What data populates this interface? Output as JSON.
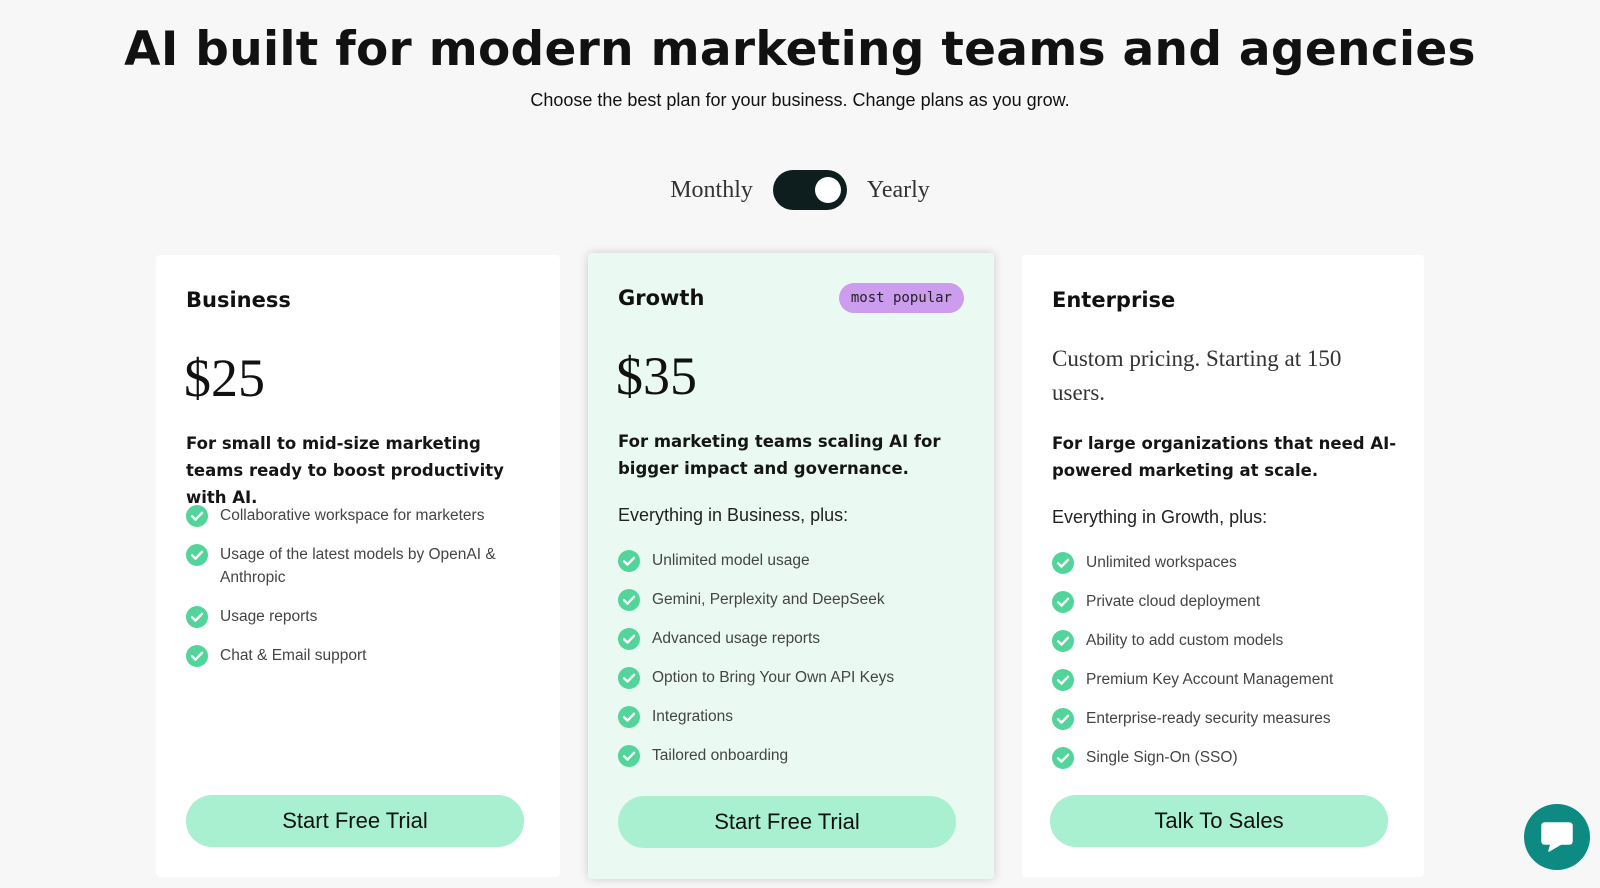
{
  "header": {
    "title": "AI built for modern marketing teams and agencies",
    "subtitle": "Choose the best plan for your business. Change plans as you grow."
  },
  "billing": {
    "monthly_label": "Monthly",
    "yearly_label": "Yearly",
    "selected": "Yearly"
  },
  "plans": [
    {
      "name": "Business",
      "price": "$25",
      "tagline": "For small to mid-size marketing teams ready to boost productivity with AI.",
      "features": [
        "Collaborative workspace for marketers",
        "Usage of the latest models by OpenAI & Anthropic",
        "Usage reports",
        "Chat & Email support"
      ],
      "cta": "Start Free Trial"
    },
    {
      "name": "Growth",
      "badge": "most popular",
      "price": "$35",
      "tagline": "For marketing teams scaling AI for bigger impact and governance.",
      "includes": "Everything in Business, plus:",
      "features": [
        "Unlimited model usage",
        "Gemini, Perplexity and DeepSeek",
        "Advanced usage reports",
        "Option to Bring Your Own API Keys",
        "Integrations",
        "Tailored onboarding"
      ],
      "cta": "Start Free Trial"
    },
    {
      "name": "Enterprise",
      "price_text": "Custom pricing. Starting at 150 users.",
      "tagline": "For large organizations that need AI-powered marketing at scale.",
      "includes": "Everything in Growth, plus:",
      "features": [
        "Unlimited workspaces",
        "Private cloud deployment",
        "Ability to add custom models",
        "Premium Key Account Management",
        "Enterprise-ready security measures",
        "Single Sign-On (SSO)"
      ],
      "cta": "Talk To Sales"
    }
  ],
  "icons": {
    "check": "check-circle-icon",
    "chat": "chat-bubble-icon"
  },
  "colors": {
    "accent_mint": "#a8f0d0",
    "check_green": "#52d49b",
    "badge_purple": "#cc9cee",
    "growth_bg": "#eafaf3",
    "chat_teal": "#0d8a82",
    "toggle_dark": "#0e1d1d"
  }
}
